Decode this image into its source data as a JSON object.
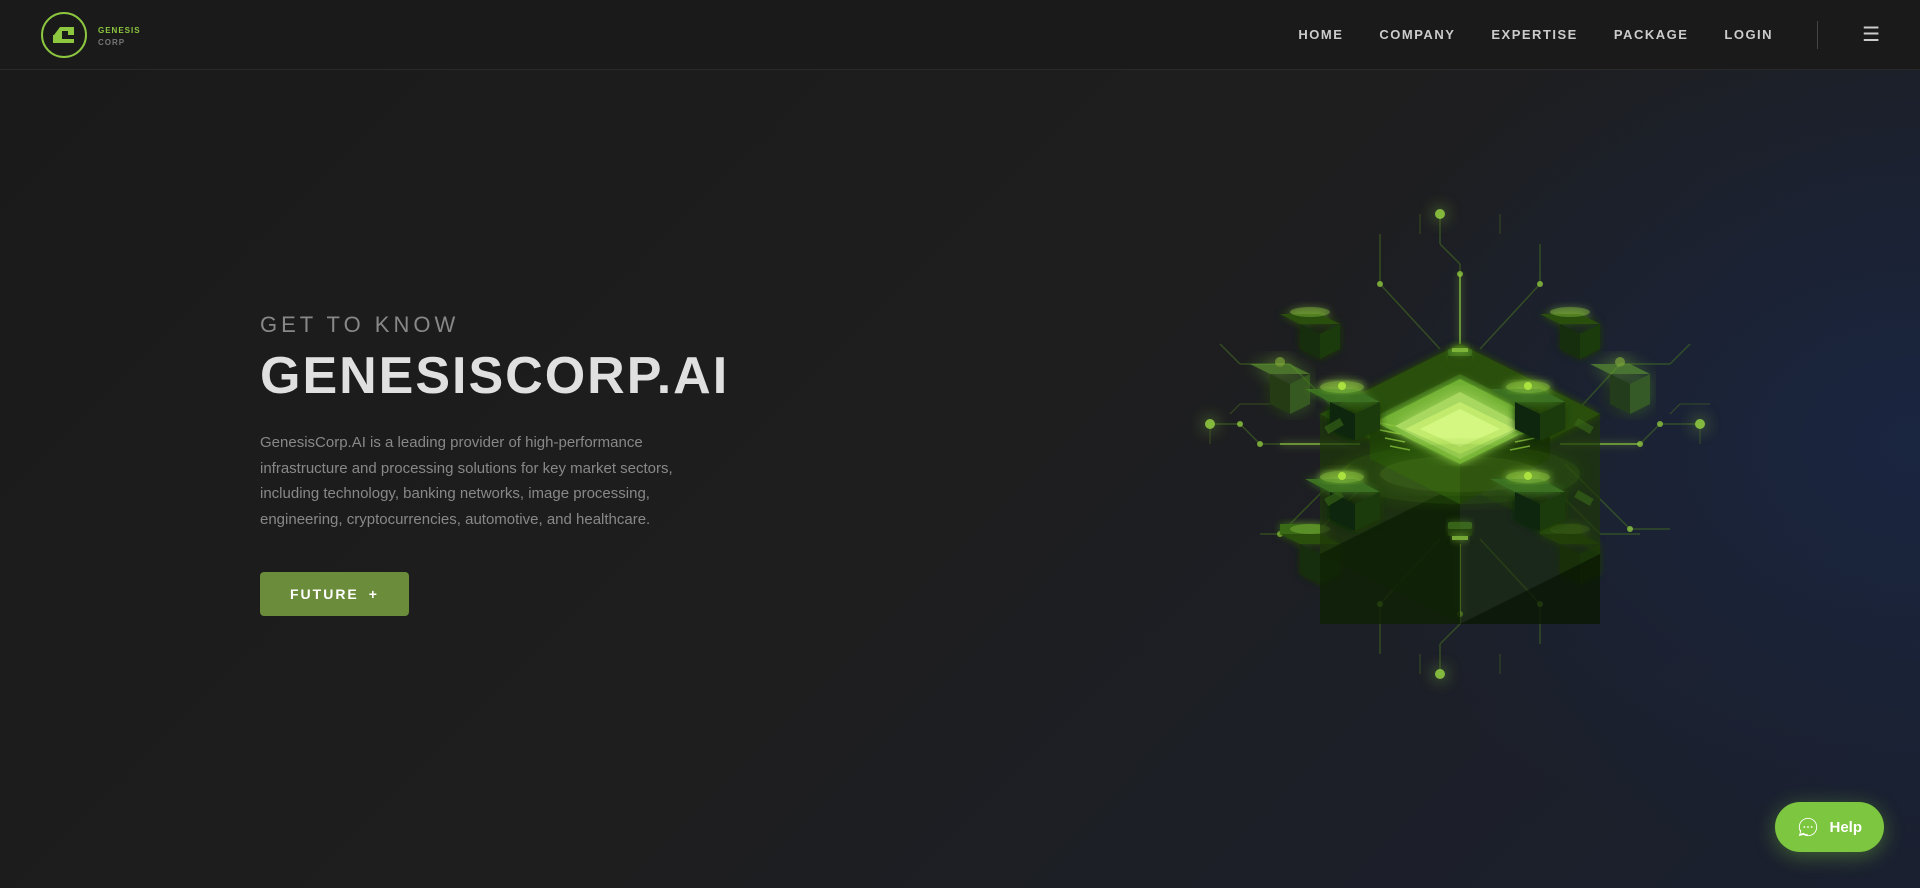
{
  "nav": {
    "logo_text": "GENESIS CORP",
    "links": [
      {
        "label": "HOME",
        "id": "home"
      },
      {
        "label": "COMPANY",
        "id": "company"
      },
      {
        "label": "EXPERTISE",
        "id": "expertise"
      },
      {
        "label": "PACKAGE",
        "id": "package"
      },
      {
        "label": "LOGIN",
        "id": "login"
      }
    ]
  },
  "hero": {
    "subtitle": "GET TO KNOW",
    "title": "GENESISCORP.AI",
    "description": "GenesisCorp.AI is a leading provider of high-performance infrastructure and processing solutions for key market sectors, including technology, banking networks, image processing, engineering, cryptocurrencies, automotive, and healthcare.",
    "cta_label": "FUTURE",
    "cta_arrow": "→"
  },
  "chat": {
    "label": "Help"
  }
}
